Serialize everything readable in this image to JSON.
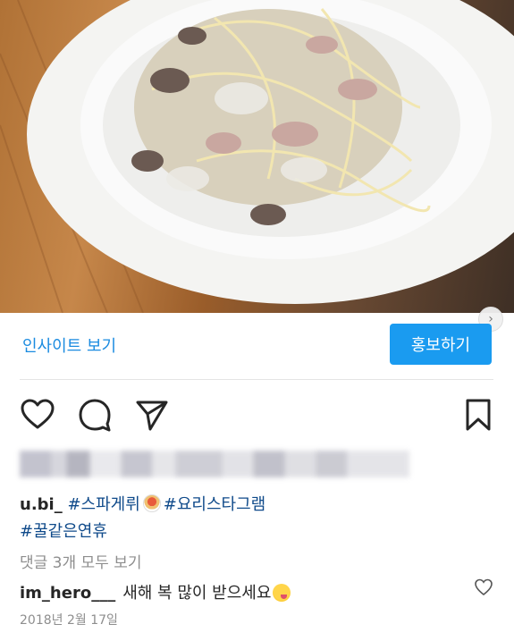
{
  "post": {
    "insights_label": "인사이트 보기",
    "promote_label": "홍보하기",
    "caption": {
      "username": "u.bi_",
      "tag1": "#스파게뤼",
      "tag2": "#요리스타그램",
      "tag3": "#꿀같은연휴"
    },
    "view_comments": "댓글 3개 모두 보기",
    "comment": {
      "username": "im_hero___",
      "text": "새해 복 많이 받으세요"
    },
    "date": "2018년 2월 17일"
  },
  "icons": {
    "like": "heart-icon",
    "comment": "comment-bubble-icon",
    "share": "send-icon",
    "save": "bookmark-icon",
    "next": "chevron-right-icon"
  },
  "colors": {
    "link_blue": "#1a8be0",
    "button_blue": "#1a9bf0",
    "hashtag": "#0f4a8a",
    "muted_text": "#8e8e8e"
  }
}
